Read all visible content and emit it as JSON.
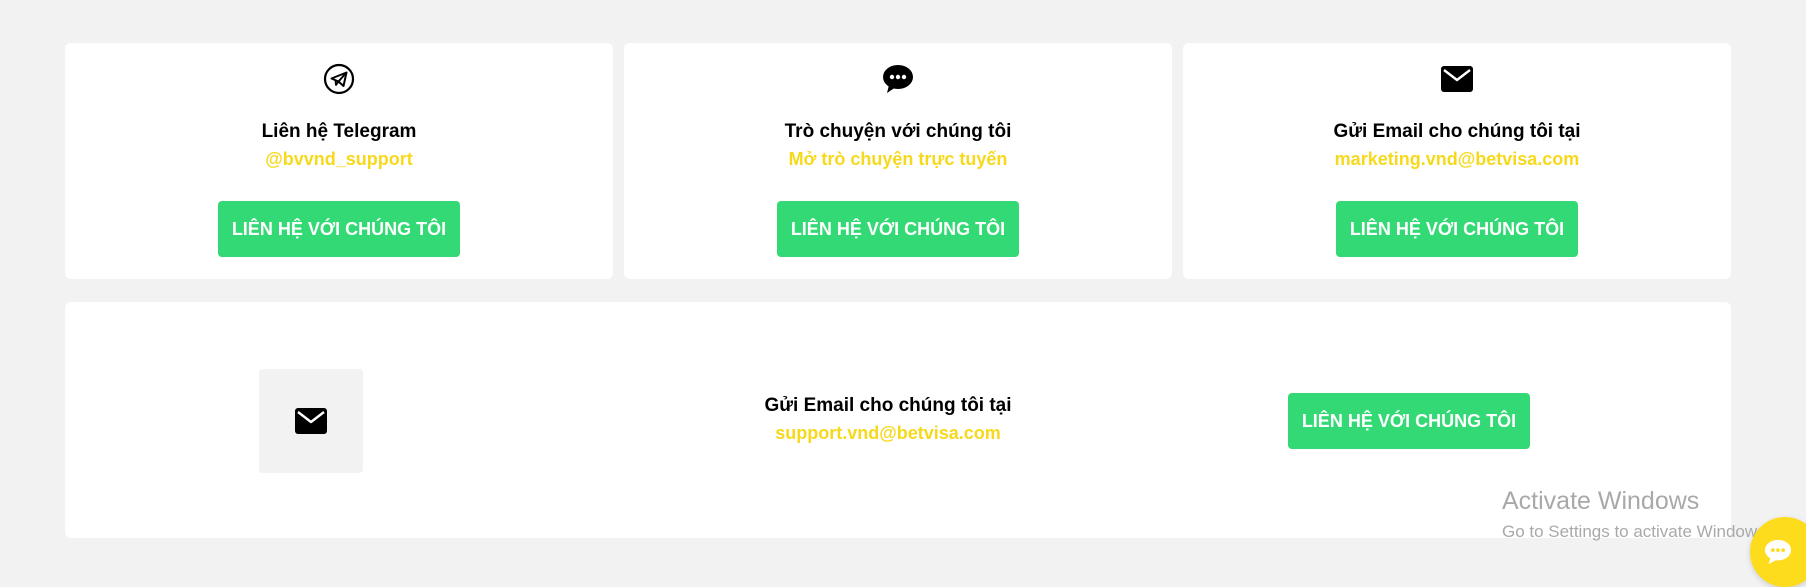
{
  "cards": [
    {
      "icon": "telegram-icon",
      "title": "Liên hệ Telegram",
      "subtitle": "@bvvnd_support",
      "button_label": "LIÊN HỆ VỚI CHÚNG TÔI"
    },
    {
      "icon": "chat-bubble-icon",
      "title": "Trò chuyện với chúng tôi",
      "subtitle": "Mở trò chuyện trực tuyến",
      "button_label": "LIÊN HỆ VỚI CHÚNG TÔI"
    },
    {
      "icon": "envelope-icon",
      "title": "Gửi Email cho chúng tôi tại",
      "subtitle": "marketing.vnd@betvisa.com",
      "button_label": "LIÊN HỆ VỚI CHÚNG TÔI"
    }
  ],
  "support_card": {
    "icon": "envelope-icon",
    "title": "Gửi Email cho chúng tôi tại",
    "subtitle": "support.vnd@betvisa.com",
    "button_label": "LIÊN HỆ VỚI CHÚNG TÔI"
  },
  "watermark": {
    "title": "Activate Windows",
    "subtitle": "Go to Settings to activate Windows."
  },
  "chat_widget": {
    "icon": "chat-bubble-icon"
  },
  "colors": {
    "page_background": "#f2f2f2",
    "card_background": "#ffffff",
    "accent_yellow": "#f7d91c",
    "button_green": "#33d974",
    "chat_widget_yellow": "#fddc1e"
  }
}
